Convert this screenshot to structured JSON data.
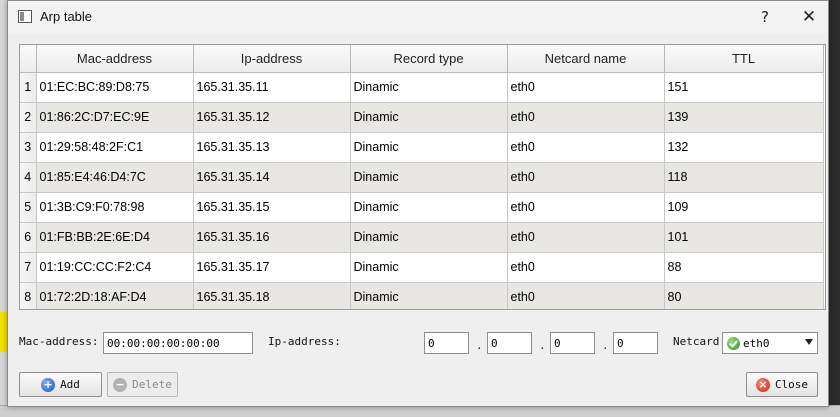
{
  "window": {
    "title": "Arp table",
    "help_glyph": "?",
    "close_glyph": "✕"
  },
  "table": {
    "columns": [
      "Mac-address",
      "Ip-address",
      "Record type",
      "Netcard name",
      "TTL"
    ],
    "rows": [
      {
        "n": "1",
        "mac": "01:EC:BC:89:D8:75",
        "ip": "165.31.35.11",
        "type": "Dinamic",
        "netcard": "eth0",
        "ttl": "151"
      },
      {
        "n": "2",
        "mac": "01:86:2C:D7:EC:9E",
        "ip": "165.31.35.12",
        "type": "Dinamic",
        "netcard": "eth0",
        "ttl": "139"
      },
      {
        "n": "3",
        "mac": "01:29:58:48:2F:C1",
        "ip": "165.31.35.13",
        "type": "Dinamic",
        "netcard": "eth0",
        "ttl": "132"
      },
      {
        "n": "4",
        "mac": "01:85:E4:46:D4:7C",
        "ip": "165.31.35.14",
        "type": "Dinamic",
        "netcard": "eth0",
        "ttl": "118"
      },
      {
        "n": "5",
        "mac": "01:3B:C9:F0:78:98",
        "ip": "165.31.35.15",
        "type": "Dinamic",
        "netcard": "eth0",
        "ttl": "109"
      },
      {
        "n": "6",
        "mac": "01:FB:BB:2E:6E:D4",
        "ip": "165.31.35.16",
        "type": "Dinamic",
        "netcard": "eth0",
        "ttl": "101"
      },
      {
        "n": "7",
        "mac": "01:19:CC:CC:F2:C4",
        "ip": "165.31.35.17",
        "type": "Dinamic",
        "netcard": "eth0",
        "ttl": "88"
      },
      {
        "n": "8",
        "mac": "01:72:2D:18:AF:D4",
        "ip": "165.31.35.18",
        "type": "Dinamic",
        "netcard": "eth0",
        "ttl": "80"
      }
    ]
  },
  "form": {
    "mac_label": "Mac-address:",
    "mac_value": "00:00:00:00:00:00",
    "ip_label": "Ip-address:",
    "ip_octets": [
      "0",
      "0",
      "0",
      "0"
    ],
    "ip_separator": ".",
    "netcard_label": "Netcard",
    "netcard_selected": "eth0"
  },
  "buttons": {
    "add": "Add",
    "delete": "Delete",
    "close": "Close"
  },
  "icons": {
    "add": "plus-icon",
    "delete": "minus-icon",
    "close": "close-circle-icon",
    "netcard": "check-circle-icon"
  }
}
